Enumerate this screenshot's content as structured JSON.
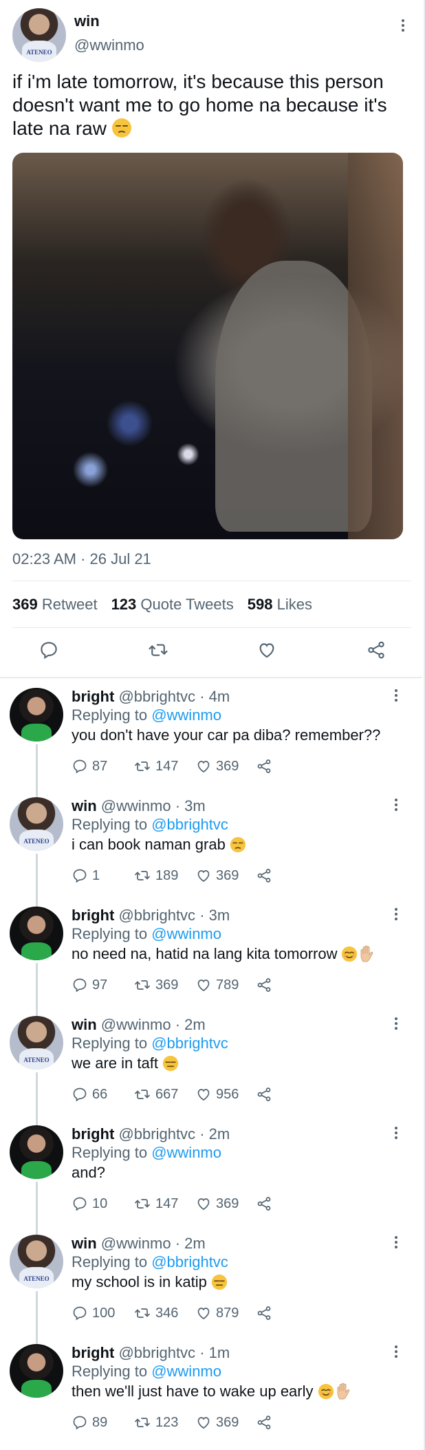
{
  "main_tweet": {
    "name": "win",
    "handle": "@wwinmo",
    "avatar_text": "ATENEO",
    "text": "if i'm late tomorrow, it's because this person doesn't want me to go home na because it's late na raw",
    "text_emoji": "unamused-face",
    "timestamp": "02:23 AM · 26 Jul 21",
    "stats": {
      "retweets_count": "369",
      "retweets_label": "Retweet",
      "quotes_count": "123",
      "quotes_label": "Quote Tweets",
      "likes_count": "598",
      "likes_label": "Likes"
    },
    "actions": [
      "reply-icon",
      "retweet-icon",
      "like-icon",
      "share-icon"
    ]
  },
  "replies": [
    {
      "name": "bright",
      "handle": "@bbrightvc",
      "time": "· 4m",
      "replying_label": "Replying to",
      "replying_to": "@wwinmo",
      "text": "you don't have your car pa diba? remember??",
      "replies": "87",
      "retweets": "147",
      "likes": "369"
    },
    {
      "name": "win",
      "handle": "@wwinmo",
      "time": "· 3m",
      "replying_label": "Replying to",
      "replying_to": "@bbrightvc",
      "text": "i can book naman grab",
      "replies": "1",
      "retweets": "189",
      "likes": "369"
    },
    {
      "name": "bright",
      "handle": "@bbrightvc",
      "time": "· 3m",
      "replying_label": "Replying to",
      "replying_to": "@wwinmo",
      "text": "no need na, hatid na lang kita tomorrow",
      "replies": "97",
      "retweets": "369",
      "likes": "789"
    },
    {
      "name": "win",
      "handle": "@wwinmo",
      "time": "· 2m",
      "replying_label": "Replying to",
      "replying_to": "@bbrightvc",
      "text": "we are in taft",
      "replies": "66",
      "retweets": "667",
      "likes": "956"
    },
    {
      "name": "bright",
      "handle": "@bbrightvc",
      "time": "· 2m",
      "replying_label": "Replying to",
      "replying_to": "@wwinmo",
      "text": "and?",
      "replies": "10",
      "retweets": "147",
      "likes": "369"
    },
    {
      "name": "win",
      "handle": "@wwinmo",
      "time": "· 2m",
      "replying_label": "Replying to",
      "replying_to": "@bbrightvc",
      "text": "my school is in katip",
      "replies": "100",
      "retweets": "346",
      "likes": "879"
    },
    {
      "name": "bright",
      "handle": "@bbrightvc",
      "time": "· 1m",
      "replying_label": "Replying to",
      "replying_to": "@wwinmo",
      "text": "then we'll just have to wake up early",
      "replies": "89",
      "retweets": "123",
      "likes": "369"
    }
  ],
  "colors": {
    "accent": "#1d9bf0",
    "secondary_text": "#536471",
    "primary_text": "#0f1419",
    "divider": "#e6ecf0"
  }
}
